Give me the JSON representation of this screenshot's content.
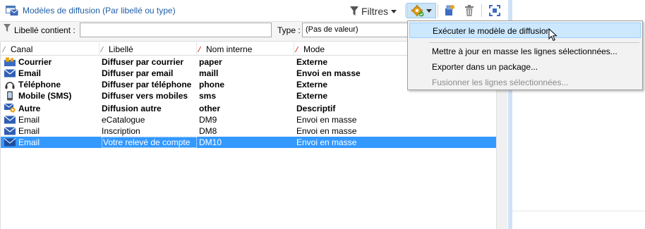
{
  "header": {
    "title": "Modèles de diffusion (Par libellé ou type)",
    "filters_label": "Filtres"
  },
  "filter_bar": {
    "label_contains": "Libellé contient :",
    "label_value": "",
    "type_label": "Type :",
    "type_value": "(Pas de valeur)"
  },
  "grid": {
    "columns": [
      "Canal",
      "Libellé",
      "Nom interne",
      "Mode"
    ],
    "rows": [
      {
        "icon": "mail-envelope-icon",
        "canal": "Courrier",
        "libelle": "Diffuser par courrier",
        "nom_interne": "paper",
        "mode": "Externe"
      },
      {
        "icon": "email-icon",
        "canal": "Email",
        "libelle": "Diffuser par email",
        "nom_interne": "maill",
        "mode": "Envoi en masse"
      },
      {
        "icon": "headset-icon",
        "canal": "Téléphone",
        "libelle": "Diffuser par téléphone",
        "nom_interne": "phone",
        "mode": "Externe"
      },
      {
        "icon": "mobile-phone-icon",
        "canal": "Mobile (SMS)",
        "libelle": "Diffuser vers mobiles",
        "nom_interne": "sms",
        "mode": "Externe"
      },
      {
        "icon": "other-channel-icon",
        "canal": "Autre",
        "libelle": "Diffusion autre",
        "nom_interne": "other",
        "mode": "Descriptif"
      },
      {
        "icon": "email-icon",
        "canal": "Email",
        "libelle": "eCatalogue",
        "nom_interne": "DM9",
        "mode": "Envoi en masse"
      },
      {
        "icon": "email-icon",
        "canal": "Email",
        "libelle": "Inscription",
        "nom_interne": "DM8",
        "mode": "Envoi en masse"
      },
      {
        "icon": "email-icon",
        "canal": "Email",
        "libelle": "Votre relevé de compte",
        "nom_interne": "DM10",
        "mode": "Envoi en masse"
      }
    ]
  },
  "menu": {
    "items": [
      "Exécuter le modèle de diffusion",
      "Mettre à jour en masse les lignes sélectionnées...",
      "Exporter dans un package...",
      "Fusionner les lignes sélectionnées..."
    ]
  },
  "colors": {
    "title_blue": "#1f5fa8",
    "selection_blue": "#3399ff",
    "menu_highlight": "#cce8ff"
  }
}
